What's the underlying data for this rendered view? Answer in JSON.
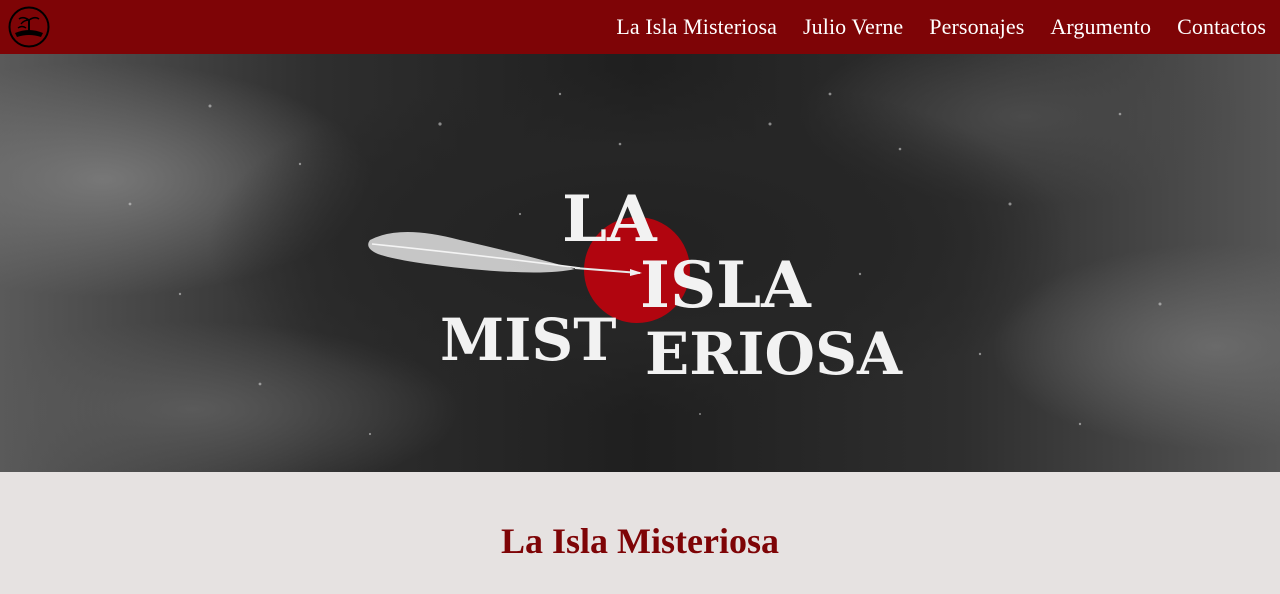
{
  "navbar": {
    "logo_icon": "island-logo-icon",
    "links": [
      {
        "label": "La Isla Misteriosa"
      },
      {
        "label": "Julio Verne"
      },
      {
        "label": "Personajes"
      },
      {
        "label": "Argumento"
      },
      {
        "label": "Contactos"
      }
    ]
  },
  "hero": {
    "title_line1": "LA",
    "title_line2": "ISLA",
    "title_line3a": "MIST",
    "title_line3b": "ERIOSA",
    "accent_icon": "feather-quill-icon"
  },
  "main": {
    "section_title": "La Isla Misteriosa"
  },
  "colors": {
    "brand": "#7e0406",
    "background": "#e6e2e1",
    "hero_circle": "#b1050f"
  }
}
